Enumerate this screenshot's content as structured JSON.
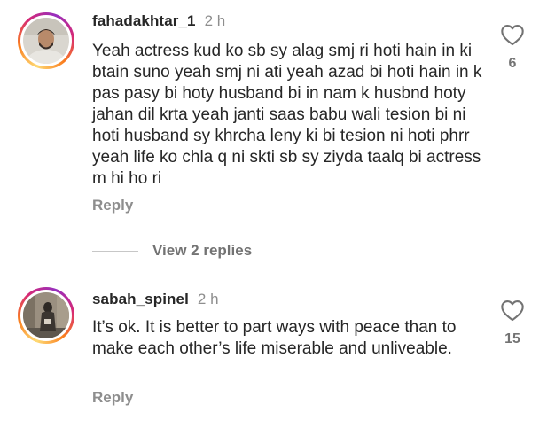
{
  "comments": [
    {
      "username": "fahadakhtar_1",
      "time": "2 h",
      "text": "Yeah actress kud ko sb sy alag smj ri hoti hain in ki btain suno yeah smj ni ati yeah azad bi hoti hain in k pas pasy bi hoty husband bi in nam k husbnd hoty jahan dil krta yeah janti saas babu wali tesion bi ni hoti husband sy khrcha leny ki bi tesion ni hoti phrr yeah life ko chla q ni skti sb sy ziyda taalq bi actress m hi ho ri",
      "reply_label": "Reply",
      "likes": "6",
      "like_icon": "heart-outline-icon"
    },
    {
      "username": "sabah_spinel",
      "time": "2 h",
      "text": "It’s ok. It is better to part ways with peace than to make each other’s life miserable and unliveable.",
      "reply_label": "Reply",
      "likes": "15",
      "like_icon": "heart-outline-icon"
    }
  ],
  "view_replies": {
    "label": "View 2 replies"
  },
  "colors": {
    "text": "#262626",
    "muted": "#8e8e8e",
    "story_ring_start": "#feda75",
    "story_ring_mid": "#d62976",
    "story_ring_end": "#962fbf"
  }
}
